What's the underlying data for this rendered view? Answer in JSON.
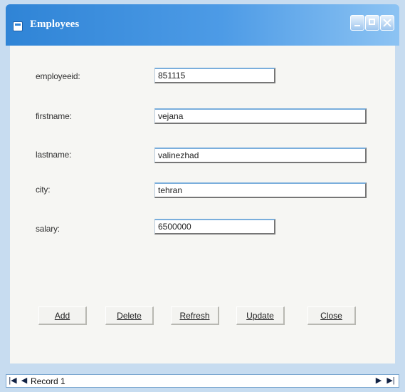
{
  "window": {
    "title": "Employees"
  },
  "form": {
    "fields": [
      {
        "label": "employeeid:",
        "value": "851115"
      },
      {
        "label": "firstname:",
        "value": "vejana"
      },
      {
        "label": "lastname:",
        "value": "valinezhad"
      },
      {
        "label": "city:",
        "value": "tehran"
      },
      {
        "label": "salary:",
        "value": "6500000"
      }
    ]
  },
  "buttons": {
    "add": "Add",
    "delete": "Delete",
    "refresh": "Refresh",
    "update": "Update",
    "close": "Close"
  },
  "navigator": {
    "first_icon": "first-record-icon",
    "prev_icon": "previous-record-icon",
    "next_icon": "next-record-icon",
    "last_icon": "last-record-icon",
    "record_label": "Record 1"
  },
  "colors": {
    "titlebar_start": "#2f84d6",
    "titlebar_end": "#8cc3f3",
    "window_frame": "#c7dcf0"
  }
}
